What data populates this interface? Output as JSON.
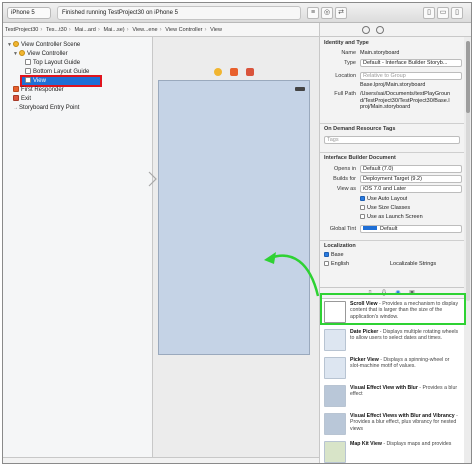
{
  "toolbar": {
    "scheme": "iPhone 5",
    "activity": "Finished running TestProject30 on iPhone 5"
  },
  "jumpbar": {
    "items": [
      "TestProject30",
      "Tes...t30",
      "Mai...ard",
      "Mai...se)",
      "View...ene",
      "View Controller",
      "View"
    ]
  },
  "outline": {
    "scene": "View Controller Scene",
    "controller": "View Controller",
    "top_guide": "Top Layout Guide",
    "bottom_guide": "Bottom Layout Guide",
    "view": "View",
    "first_responder": "First Responder",
    "exit": "Exit",
    "entry_point": "Storyboard Entry Point"
  },
  "inspector": {
    "identity_title": "Identity and Type",
    "name_label": "Name",
    "name_value": "Main.storyboard",
    "type_label": "Type",
    "type_value": "Default - Interface Builder Storyb...",
    "location_label": "Location",
    "location_value": "Relative to Group",
    "location_file": "Base.lproj/Main.storyboard",
    "fullpath_label": "Full Path",
    "fullpath_value": "/Users/sai/Documents/testPlayGround/TestProject30/TestProject30/Base.lproj/Main.storyboard",
    "ondemand_title": "On Demand Resource Tags",
    "tags_placeholder": "Tags",
    "ibdoc_title": "Interface Builder Document",
    "opens_label": "Opens in",
    "opens_value": "Default (7.0)",
    "builds_label": "Builds for",
    "builds_value": "Deployment Target (9.2)",
    "viewas_label": "View as",
    "viewas_value": "iOS 7.0 and Later",
    "autolayout": "Use Auto Layout",
    "sizeclasses": "Use Size Classes",
    "launchscreen": "Use as Launch Screen",
    "globaltint_label": "Global Tint",
    "globaltint_value": "Default",
    "localization_title": "Localization",
    "loc_base": "Base",
    "loc_english": "English",
    "loc_strings": "Localizable Strings"
  },
  "library": {
    "items": [
      {
        "title": "Scroll View",
        "desc": " - Provides a mechanism to display content that is larger than the size of the application's window."
      },
      {
        "title": "Date Picker",
        "desc": " - Displays multiple rotating wheels to allow users to select dates and times."
      },
      {
        "title": "Picker View",
        "desc": " - Displays a spinning-wheel or slot-machine motif of values."
      },
      {
        "title": "Visual Effect View with Blur",
        "desc": " - Provides a blur effect"
      },
      {
        "title": "Visual Effect Views with Blur and Vibrancy",
        "desc": " - Provides a blur effect, plus vibrancy for nested views"
      },
      {
        "title": "Map Kit View",
        "desc": " - Displays maps and provides"
      }
    ]
  },
  "colors": {
    "selection": "#1f6fd6",
    "red_highlight": "#e0141e",
    "green_highlight": "#2ed233",
    "canvas_view": "#c5d3e6"
  }
}
